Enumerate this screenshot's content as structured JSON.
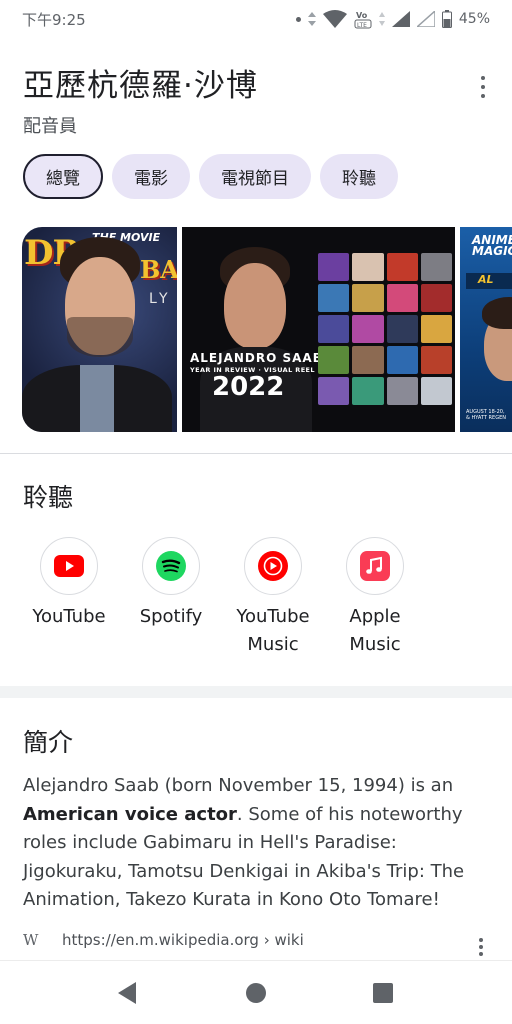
{
  "status_bar": {
    "time": "下午9:25",
    "battery": "45%",
    "icons": [
      "notification-dot-icon",
      "data-arrows-icon",
      "wifi-icon",
      "volte-icon",
      "signal-icon",
      "signal-empty-icon",
      "battery-icon"
    ]
  },
  "header": {
    "title": "亞歷杭德羅·沙博",
    "subtitle": "配音員"
  },
  "chips": [
    "總覽",
    "電影",
    "電視節目",
    "聆聽"
  ],
  "images": {
    "card1": {
      "logo": "DR",
      "movie_label": "THE MOVIE",
      "logo2": "BAL",
      "sub": "LY"
    },
    "card2": {
      "name": "ALEJANDRO SAAB",
      "tagline": "YEAR IN REVIEW · VISUAL REEL",
      "year": "2022"
    },
    "card3": {
      "title_line1": "ANIME",
      "title_line2": "MAGIC",
      "ticket": "AL",
      "foot_line1": "AUGUST 18-20,",
      "foot_line2": "& HYATT REGEN"
    }
  },
  "listen": {
    "title": "聆聽",
    "apps": [
      {
        "label": "YouTube",
        "icon": "youtube-icon",
        "color": "#ff0000"
      },
      {
        "label": "Spotify",
        "icon": "spotify-icon",
        "color": "#1ed760"
      },
      {
        "label_line1": "YouTube",
        "label_line2": "Music",
        "icon": "youtube-music-icon",
        "color": "#ff0000"
      },
      {
        "label_line1": "Apple",
        "label_line2": "Music",
        "icon": "apple-music-icon",
        "color": "#fa3c55"
      }
    ]
  },
  "about": {
    "title": "簡介",
    "text_before": "Alejandro Saab (born November 15, 1994) is an ",
    "text_bold": "American voice actor",
    "text_after": ". Some of his noteworthy roles include Gabimaru in Hell's Paradise: Jigokuraku, Tamotsu Denkigai in Akiba's Trip: The Animation, Takezo Kurata in Kono Oto Tomare!",
    "source_letter": "W",
    "source_url": "https://en.m.wikipedia.org › wiki"
  },
  "nav": {
    "icons": [
      "back-icon",
      "home-icon",
      "recents-icon"
    ]
  }
}
